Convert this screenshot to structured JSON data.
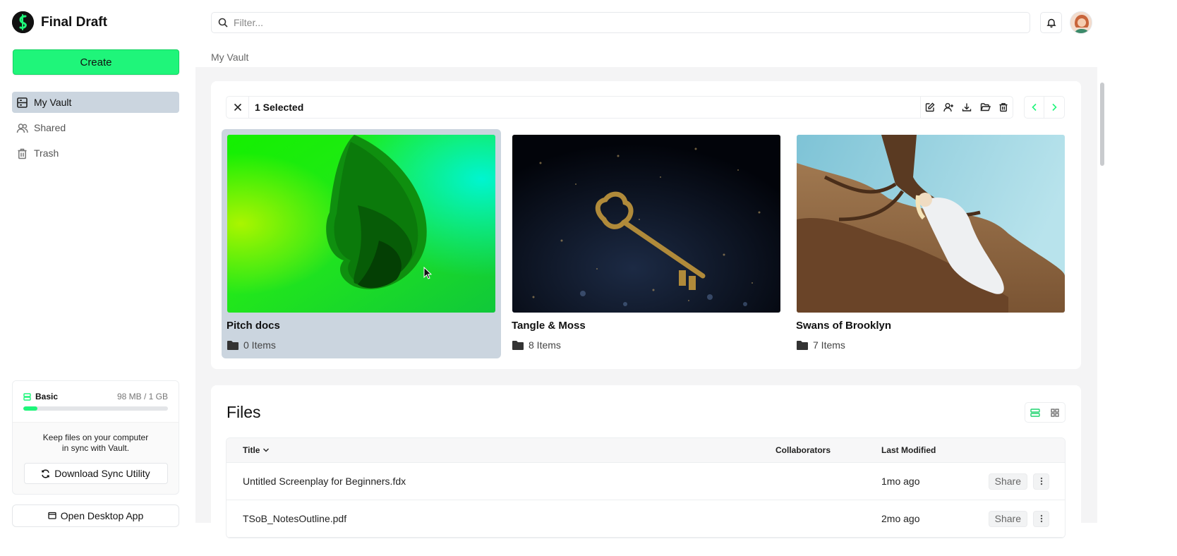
{
  "app": {
    "name": "Final Draft",
    "logo_icon": "final-draft-logo-icon"
  },
  "sidebar": {
    "create_label": "Create",
    "items": [
      {
        "label": "My Vault",
        "icon": "vault-icon",
        "active": true
      },
      {
        "label": "Shared",
        "icon": "users-icon",
        "active": false
      },
      {
        "label": "Trash",
        "icon": "trash-icon",
        "active": false
      }
    ],
    "storage": {
      "plan": "Basic",
      "usage": "98 MB / 1 GB",
      "used_fraction": 0.098
    },
    "sync_text_line1": "Keep files on your computer",
    "sync_text_line2": "in sync with Vault.",
    "sync_button": "Download Sync Utility",
    "desktop_button": "Open Desktop App"
  },
  "header": {
    "search_placeholder": "Filter...",
    "search_value": ""
  },
  "breadcrumb": "My Vault",
  "selection": {
    "label": "1 Selected",
    "actions": [
      "edit-icon",
      "add-user-icon",
      "download-icon",
      "folder-open-icon",
      "trash-icon"
    ]
  },
  "folders": [
    {
      "title": "Pitch docs",
      "count": "0 Items",
      "selected": true
    },
    {
      "title": "Tangle & Moss",
      "count": "8 Items",
      "selected": false
    },
    {
      "title": "Swans of Brooklyn",
      "count": "7 Items",
      "selected": false
    }
  ],
  "files": {
    "title": "Files",
    "columns": {
      "title": "Title",
      "collaborators": "Collaborators",
      "modified": "Last Modified"
    },
    "rows": [
      {
        "title": "Untitled Screenplay for Beginners.fdx",
        "collaborators": "",
        "modified": "1mo ago",
        "action": "Share"
      },
      {
        "title": "TSoB_NotesOutline.pdf",
        "collaborators": "",
        "modified": "2mo ago",
        "action": "Share"
      }
    ]
  },
  "colors": {
    "accent": "#1ff57a",
    "selected_bg": "#cbd5df",
    "page_bg": "#f4f4f5"
  }
}
